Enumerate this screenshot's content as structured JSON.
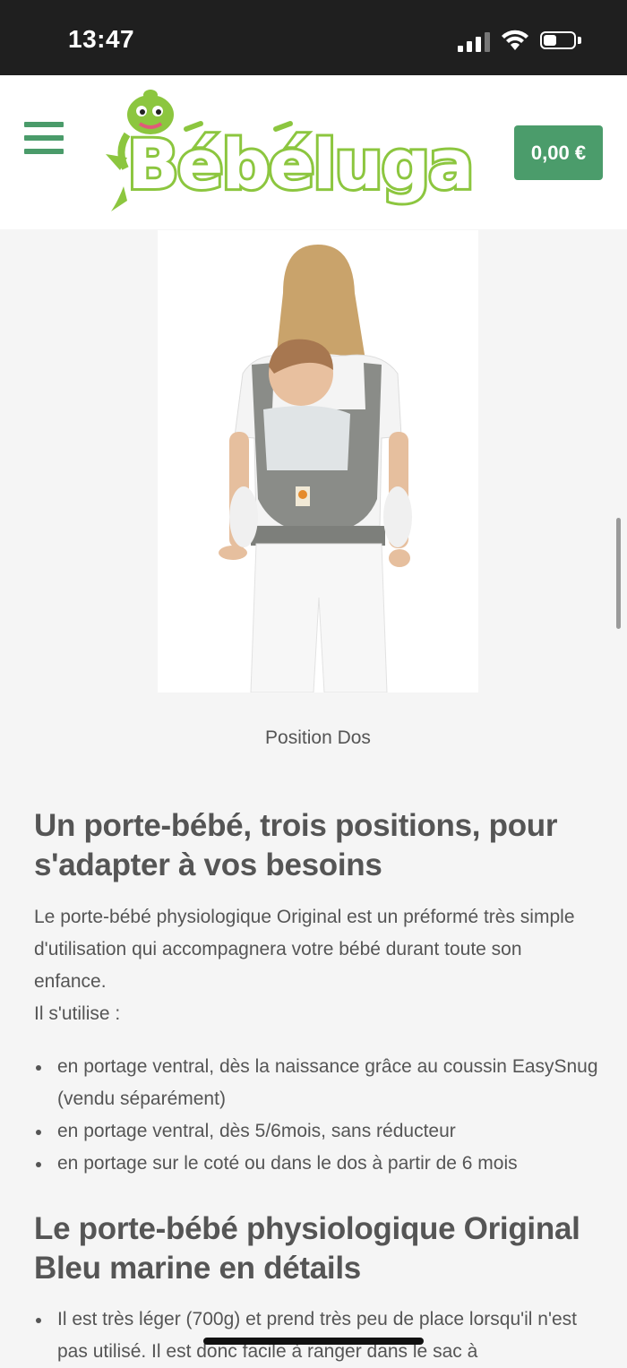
{
  "status_bar": {
    "time": "13:47"
  },
  "header": {
    "logo_text": "Bébéluga",
    "cart_total": "0,00 €"
  },
  "product": {
    "image_caption": "Position Dos"
  },
  "section1": {
    "title": "Un porte-bébé, trois positions, pour s'adapter à vos besoins",
    "intro": "Le porte-bébé physiologique Original est un préformé très simple d'utilisation qui accompagnera votre bébé durant toute son enfance.",
    "usage_label": "Il s'utilise :",
    "bullets": [
      "en portage ventral, dès la naissance grâce au coussin EasySnug (vendu séparément)",
      "en portage ventral, dès 5/6mois, sans réducteur",
      "en portage sur le coté ou dans le dos à partir de 6 mois"
    ]
  },
  "section2": {
    "title": "Le porte-bébé physiologique Original Bleu marine en détails",
    "bullets": [
      "Il est très léger (700g) et prend très peu de place lorsqu'il n'est pas utilisé. Il est donc facile à ranger dans le sac à"
    ]
  },
  "colors": {
    "brand_green": "#4b9c6b",
    "logo_lime": "#8cc63f",
    "status_bar": "#1f1f1f"
  }
}
